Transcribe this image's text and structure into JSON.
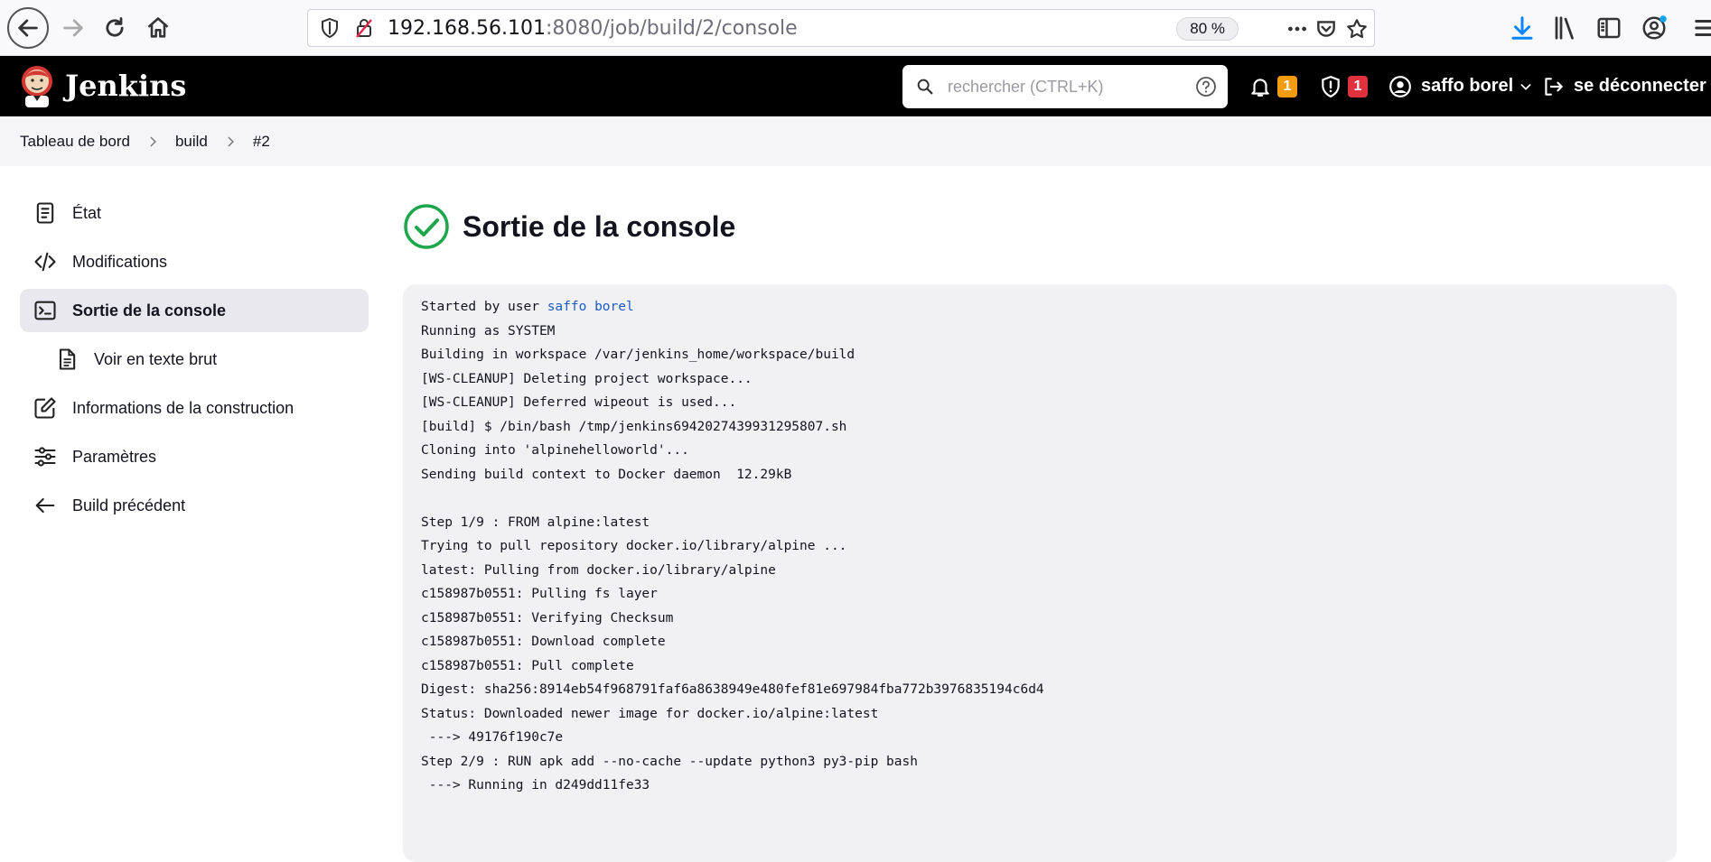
{
  "browser": {
    "url_host": "192.168.56.101",
    "url_path": ":8080/job/build/2/console",
    "zoom": "80 %"
  },
  "header": {
    "app_title": "Jenkins",
    "search_placeholder": "rechercher (CTRL+K)",
    "notifications_count": "1",
    "security_count": "1",
    "user_name": "saffo borel",
    "logout_label": "se déconnecter",
    "colors": {
      "notif_badge": "#f39c12",
      "security_badge": "#e0313f",
      "success": "#1ea64b"
    }
  },
  "breadcrumb": {
    "items": [
      "Tableau de bord",
      "build",
      "#2"
    ]
  },
  "sidebar": {
    "items": [
      {
        "label": "État",
        "icon": "document-icon"
      },
      {
        "label": "Modifications",
        "icon": "code-icon"
      },
      {
        "label": "Sortie de la console",
        "icon": "terminal-icon"
      },
      {
        "label": "Voir en texte brut",
        "icon": "text-file-icon"
      },
      {
        "label": "Informations de la construction",
        "icon": "edit-icon"
      },
      {
        "label": "Paramètres",
        "icon": "sliders-icon"
      },
      {
        "label": "Build précédent",
        "icon": "arrow-left-icon"
      }
    ]
  },
  "main": {
    "title": "Sortie de la console",
    "console_prefix": "Started by user ",
    "console_user": "saffo borel",
    "console_lines": [
      "Running as SYSTEM",
      "Building in workspace /var/jenkins_home/workspace/build",
      "[WS-CLEANUP] Deleting project workspace...",
      "[WS-CLEANUP] Deferred wipeout is used...",
      "[build] $ /bin/bash /tmp/jenkins6942027439931295807.sh",
      "Cloning into 'alpinehelloworld'...",
      "Sending build context to Docker daemon  12.29kB",
      "",
      "Step 1/9 : FROM alpine:latest",
      "Trying to pull repository docker.io/library/alpine ...",
      "latest: Pulling from docker.io/library/alpine",
      "c158987b0551: Pulling fs layer",
      "c158987b0551: Verifying Checksum",
      "c158987b0551: Download complete",
      "c158987b0551: Pull complete",
      "Digest: sha256:8914eb54f968791faf6a8638949e480fef81e697984fba772b3976835194c6d4",
      "Status: Downloaded newer image for docker.io/alpine:latest",
      " ---> 49176f190c7e",
      "Step 2/9 : RUN apk add --no-cache --update python3 py3-pip bash",
      " ---> Running in d249dd11fe33"
    ]
  }
}
